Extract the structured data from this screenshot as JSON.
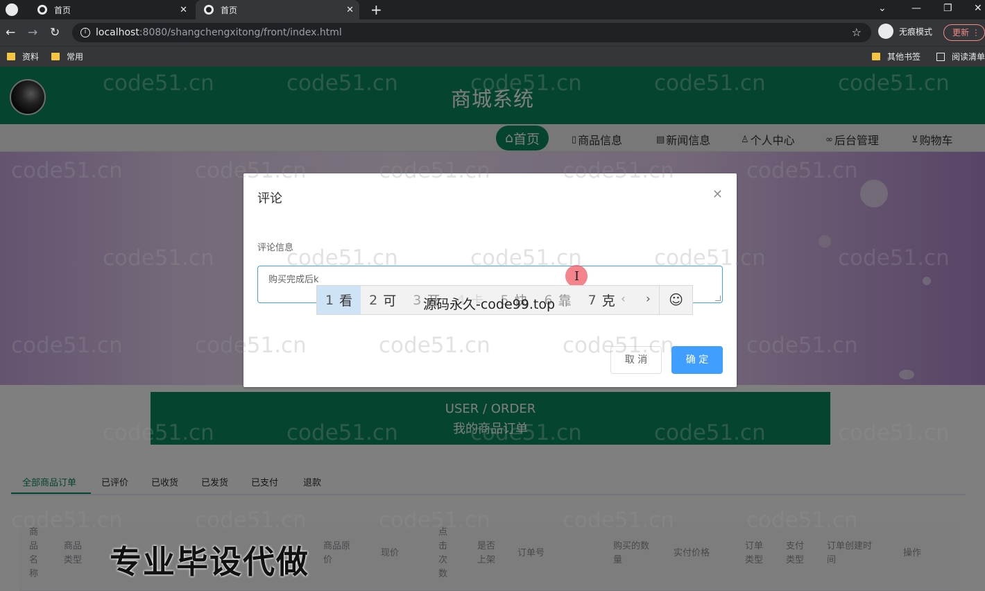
{
  "browser": {
    "tabs": [
      {
        "title": "首页",
        "active": false
      },
      {
        "title": "首页",
        "active": true
      }
    ],
    "url_host": "localhost",
    "url_rest": ":8080/shangchengxitong/front/index.html",
    "incognito_label": "无痕模式",
    "update_label": "更新",
    "bookmarks": [
      "资料",
      "常用",
      "其他书签",
      "阅读清单"
    ]
  },
  "site": {
    "title": "商城系统",
    "nav": [
      {
        "label": "首页",
        "icon": "home-icon",
        "active": true
      },
      {
        "label": "商品信息",
        "icon": "doc-icon"
      },
      {
        "label": "新闻信息",
        "icon": "news-icon"
      },
      {
        "label": "个人中心",
        "icon": "user-icon"
      },
      {
        "label": "后台管理",
        "icon": "link-icon"
      },
      {
        "label": "购物车",
        "icon": "cart-icon"
      }
    ]
  },
  "order_section": {
    "title_en": "USER / ORDER",
    "title_cn": "我的商品订单",
    "tabs": [
      "全部商品订单",
      "已评价",
      "已收货",
      "已发货",
      "已支付",
      "退款"
    ],
    "active_tab": "全部商品订单",
    "columns": [
      "商品名称",
      "商品类型",
      "商品原价",
      "现价",
      "点击次数",
      "是否上架",
      "订单号",
      "购买的数量",
      "实付价格",
      "订单类型",
      "支付类型",
      "订单创建时间",
      "操作"
    ]
  },
  "dialog": {
    "title": "评论",
    "field_label": "评论信息",
    "textarea_value": "购买完成后k",
    "cancel_label": "取 消",
    "ok_label": "确 定"
  },
  "ime": {
    "candidates": [
      {
        "num": "1",
        "text": "看"
      },
      {
        "num": "2",
        "text": "可"
      },
      {
        "num": "3",
        "text": "开"
      },
      {
        "num": "4",
        "text": "卡"
      },
      {
        "num": "5",
        "text": "快"
      },
      {
        "num": "6",
        "text": "靠"
      },
      {
        "num": "7",
        "text": "克"
      }
    ],
    "overlay_text": "源码永久-code99.top"
  },
  "overlay": {
    "watermark": "code51.cn",
    "promo": "专业毕设代做"
  }
}
